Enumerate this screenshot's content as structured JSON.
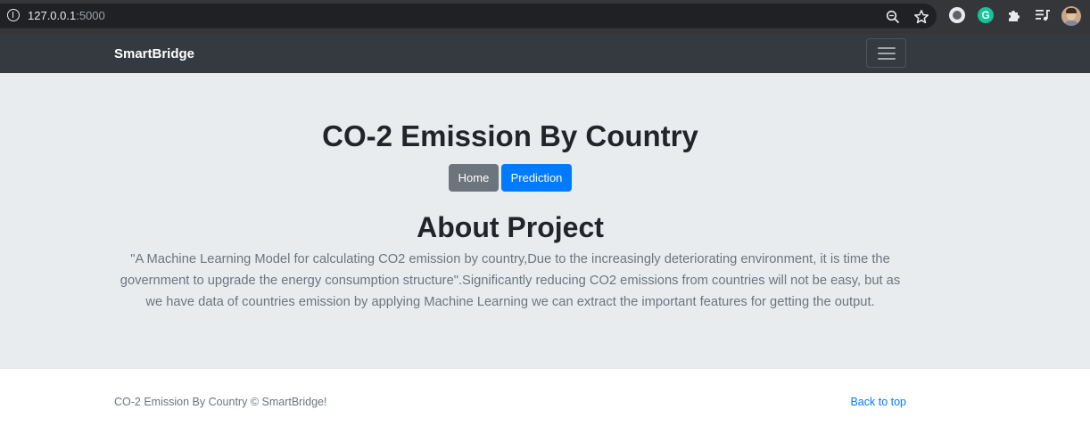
{
  "browser": {
    "url_host": "127.0.0.1",
    "url_port": ":5000",
    "grammarly_letter": "G",
    "icons": [
      "info-icon",
      "zoom-icon",
      "star-icon",
      "extension-circle-icon",
      "grammarly-icon",
      "puzzle-icon",
      "media-queue-icon",
      "profile-avatar"
    ]
  },
  "navbar": {
    "brand": "SmartBridge",
    "toggler_icon": "hamburger-icon"
  },
  "hero": {
    "title": "CO-2 Emission By Country",
    "buttons": {
      "home": "Home",
      "prediction": "Prediction"
    },
    "about_title": "About Project",
    "about_text": "\"A Machine Learning Model for calculating CO2 emission by country,Due to the increasingly deteriorating environment, it is time the government to upgrade the energy consumption structure\".Significantly reducing CO2 emissions from countries will not be easy, but as we have data of countries emission by applying Machine Learning we can extract the important features for getting the output."
  },
  "footer": {
    "copyright": "CO-2 Emission By Country © SmartBridge!",
    "back_to_top": "Back to top"
  },
  "colors": {
    "navbar_bg": "#343a40",
    "jumbotron_bg": "#e9ecef",
    "primary": "#007bff",
    "secondary": "#6c757d",
    "grammarly": "#15c39a"
  }
}
